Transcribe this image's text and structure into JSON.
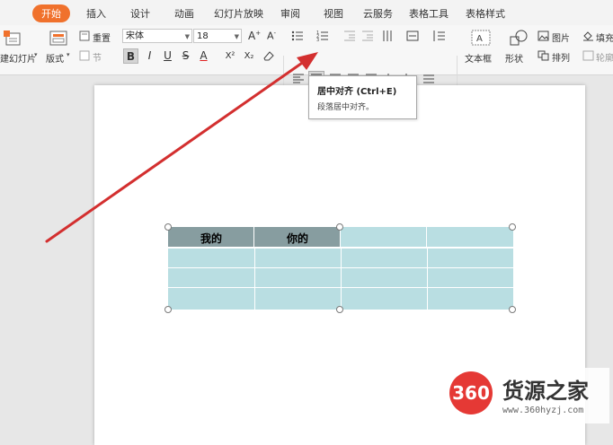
{
  "ribbon": {
    "tabs": [
      {
        "label": "开始",
        "active": true
      },
      {
        "label": "插入"
      },
      {
        "label": "设计"
      },
      {
        "label": "动画"
      },
      {
        "label": "幻灯片放映"
      },
      {
        "label": "审阅"
      },
      {
        "label": "视图"
      },
      {
        "label": "云服务"
      },
      {
        "label": "表格工具"
      },
      {
        "label": "表格样式"
      }
    ]
  },
  "toolbar": {
    "new_slide_label": "建幻灯片",
    "layout_label": "版式",
    "reset_label": "重置",
    "section_label": "节",
    "font_name": "宋体",
    "font_size": "18",
    "bold": "B",
    "italic": "I",
    "underline": "U",
    "strikethrough": "S",
    "font_color": "A",
    "superscript": "X²",
    "subscript": "X₂",
    "textbox_label": "文本框",
    "shape_label": "形状",
    "picture_label": "图片",
    "arrange_label": "排列",
    "fill_label": "填充",
    "outline_label": "轮廓"
  },
  "tooltip": {
    "title": "居中对齐 (Ctrl+E)",
    "description": "段落居中对齐。"
  },
  "table": {
    "header": [
      "我的",
      "你的",
      "",
      ""
    ],
    "rows": [
      [
        "",
        "",
        "",
        ""
      ],
      [
        "",
        "",
        "",
        ""
      ],
      [
        "",
        "",
        "",
        ""
      ]
    ]
  },
  "watermark": {
    "logo": "360",
    "title": "货源之家",
    "url": "www.360hyzj.com"
  },
  "colors": {
    "accent": "#f0712c",
    "table_header": "#879da0",
    "table_body": "#b9dee2",
    "arrow": "#d32f2f"
  }
}
